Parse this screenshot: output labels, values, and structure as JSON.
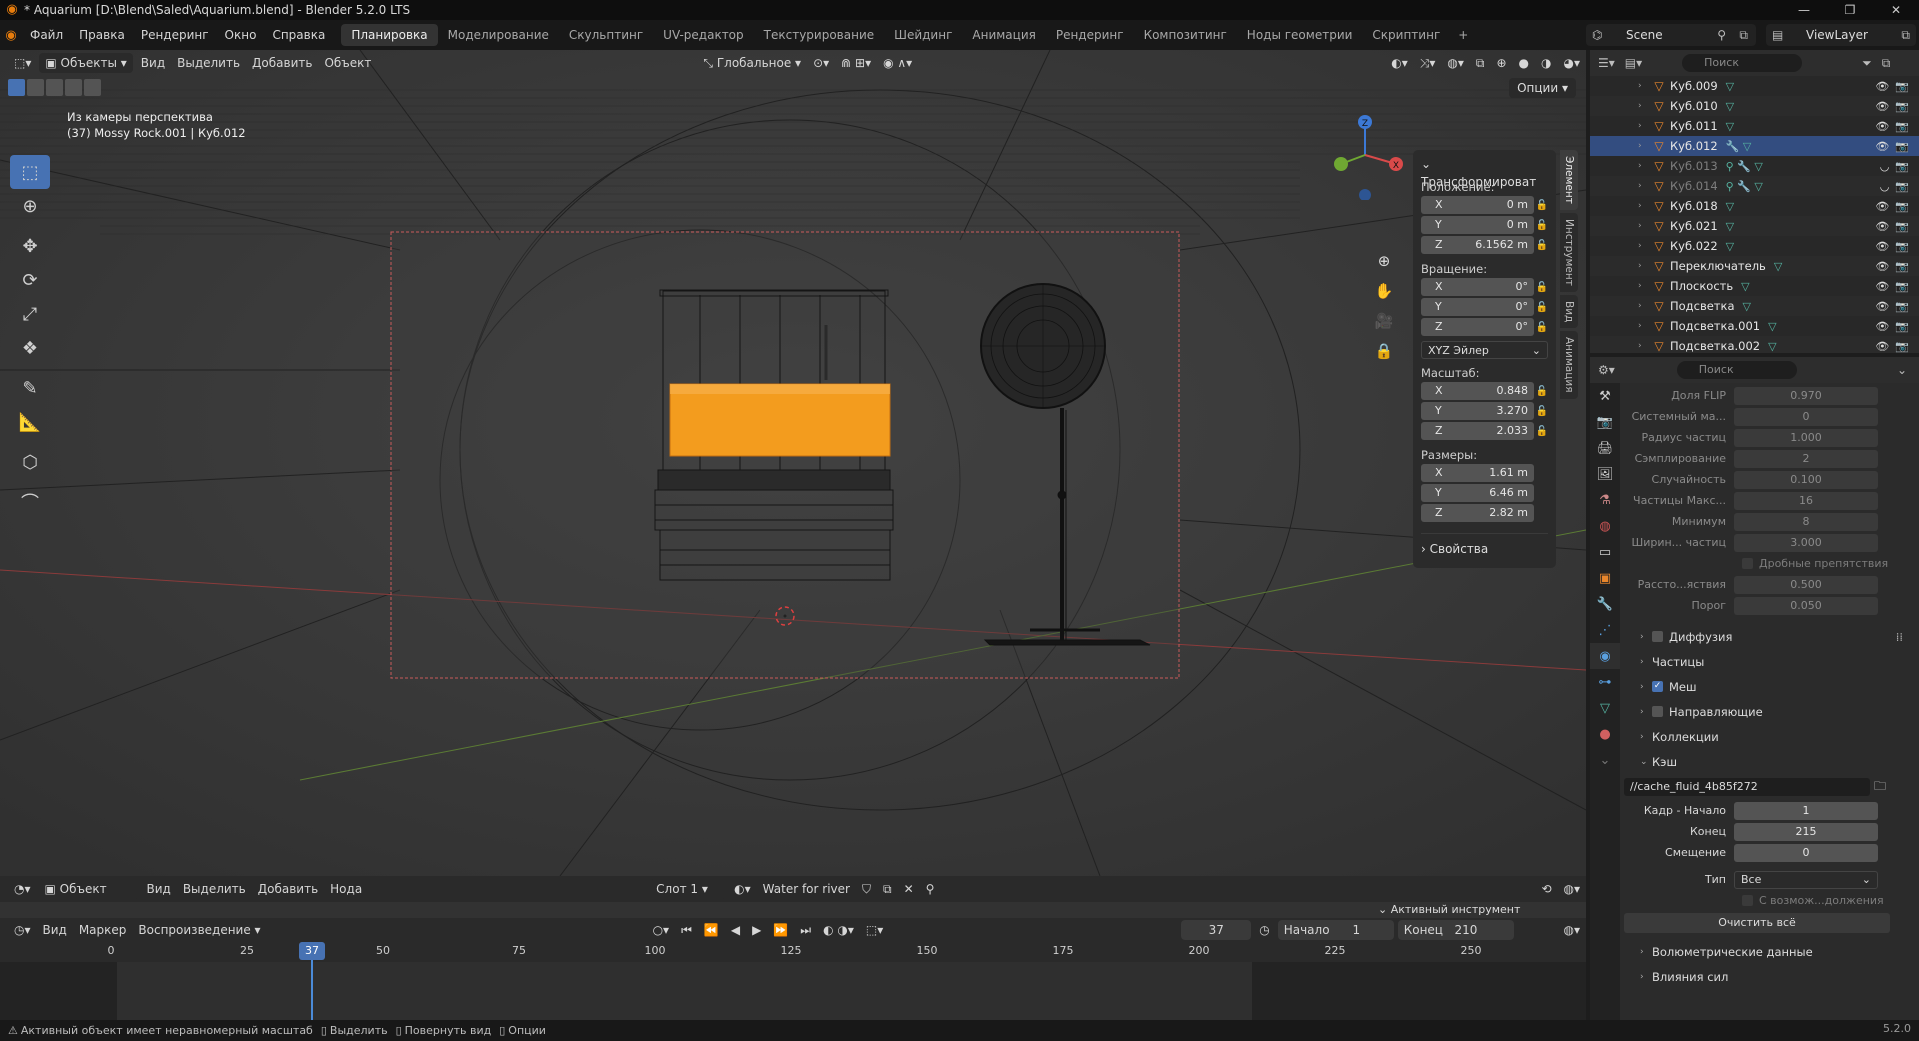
{
  "window": {
    "title": "* Aquarium [D:\\Blend\\Saled\\Aquarium.blend] - Blender 5.2.0 LTS",
    "controls": [
      "—",
      "❐",
      "✕"
    ]
  },
  "menu": [
    "Файл",
    "Правка",
    "Рендеринг",
    "Окно",
    "Справка"
  ],
  "workspaces": {
    "tabs": [
      "Планировка",
      "Моделирование",
      "Скульптинг",
      "UV-редактор",
      "Текстурирование",
      "Шейдинг",
      "Анимация",
      "Рендеринг",
      "Композитинг",
      "Ноды геометрии",
      "Скриптинг"
    ],
    "active": "Планировка"
  },
  "scene": {
    "name": "Scene",
    "view_layer": "ViewLayer"
  },
  "viewport": {
    "header": {
      "mode": "Объекты",
      "menus": [
        "Вид",
        "Выделить",
        "Добавить",
        "Объект"
      ],
      "orientation": "Глобальное"
    },
    "overlay_line1": "Из камеры перспектива",
    "overlay_line2": "(37) Mossy Rock.001 | Куб.012",
    "options": "Опции"
  },
  "npanel": {
    "section": "Трансформироват",
    "location_label": "Положение:",
    "location": {
      "x": "0 m",
      "y": "0 m",
      "z": "6.1562 m"
    },
    "rotation_label": "Вращение:",
    "rotation": {
      "x": "0°",
      "y": "0°",
      "z": "0°"
    },
    "rotation_mode": "XYZ Эйлер",
    "scale_label": "Масштаб:",
    "scale": {
      "x": "0.848",
      "y": "3.270",
      "z": "2.033"
    },
    "dims_label": "Размеры:",
    "dims": {
      "x": "1.61 m",
      "y": "6.46 m",
      "z": "2.82 m"
    },
    "props_section": "Свойства",
    "tabs": [
      "Элемент",
      "Инструмент",
      "Вид",
      "Анимация"
    ],
    "axis": {
      "x": "X",
      "y": "Y",
      "z": "Z"
    }
  },
  "shader_header": {
    "mode": "Объект",
    "menus": [
      "Вид",
      "Выделить",
      "Добавить",
      "Нода"
    ],
    "slot": "Слот 1",
    "material": "Water for river",
    "active_tool": "Активный инструмент"
  },
  "timeline": {
    "menus": [
      "Вид",
      "Маркер"
    ],
    "playback": "Воспроизведение",
    "current_frame": "37",
    "start_label": "Начало",
    "start": "1",
    "end_label": "Конец",
    "end": "210",
    "ticks": [
      "0",
      "25",
      "50",
      "75",
      "100",
      "125",
      "150",
      "175",
      "200",
      "225",
      "250"
    ],
    "cursor": "37"
  },
  "statusbar": {
    "warning": "Активный объект имеет неравномерный масштаб",
    "hints": [
      "Выделить",
      "Повернуть вид",
      "Опции"
    ],
    "version": "5.2.0"
  },
  "outliner": {
    "search_placeholder": "Поиск",
    "rows": [
      {
        "name": "Куб.009",
        "extra": "▽",
        "state": "normal"
      },
      {
        "name": "Куб.010",
        "extra": "▽",
        "state": "normal"
      },
      {
        "name": "Куб.011",
        "extra": "▽",
        "state": "normal"
      },
      {
        "name": "Куб.012",
        "extra": "🔧 ▽",
        "state": "selected"
      },
      {
        "name": "Куб.013",
        "extra": "⚲ 🔧 ▽",
        "state": "dim"
      },
      {
        "name": "Куб.014",
        "extra": "⚲ 🔧 ▽",
        "state": "dim"
      },
      {
        "name": "Куб.018",
        "extra": "▽",
        "state": "normal"
      },
      {
        "name": "Куб.021",
        "extra": "▽",
        "state": "normal"
      },
      {
        "name": "Куб.022",
        "extra": "▽",
        "state": "normal"
      },
      {
        "name": "Переключатель",
        "extra": "▽",
        "state": "normal"
      },
      {
        "name": "Плоскость",
        "extra": "▽",
        "state": "normal"
      },
      {
        "name": "Подсветка",
        "extra": "▽",
        "state": "normal"
      },
      {
        "name": "Подсветка.001",
        "extra": "▽",
        "state": "normal"
      },
      {
        "name": "Подсветка.002",
        "extra": "▽",
        "state": "normal"
      }
    ]
  },
  "properties": {
    "search_placeholder": "Поиск",
    "fields": [
      {
        "label": "Доля FLIP",
        "value": "0.970"
      },
      {
        "label": "Системный ма...",
        "value": "0"
      },
      {
        "label": "Радиус частиц",
        "value": "1.000"
      },
      {
        "label": "Сэмплирование",
        "value": "2"
      },
      {
        "label": "Случайность",
        "value": "0.100"
      },
      {
        "label": "Частицы Макс...",
        "value": "16"
      },
      {
        "label": "Минимум",
        "value": "8"
      },
      {
        "label": "Ширин... частиц",
        "value": "3.000"
      }
    ],
    "fractional_obstacles": "Дробные препятствия",
    "fields2": [
      {
        "label": "Рассто...яствия",
        "value": "0.500"
      },
      {
        "label": "Порог",
        "value": "0.050"
      }
    ],
    "subpanels": [
      {
        "label": "Диффузия",
        "checkbox": true,
        "checked": false
      },
      {
        "label": "Частицы",
        "checkbox": false,
        "checked": false
      },
      {
        "label": "Меш",
        "checkbox": true,
        "checked": true
      },
      {
        "label": "Направляющие",
        "checkbox": true,
        "checked": false
      },
      {
        "label": "Коллекции",
        "checkbox": false,
        "checked": false
      }
    ],
    "cache": {
      "label": "Кэш",
      "path": "//cache_fluid_4b85f272",
      "frame_start_label": "Кадр - Начало",
      "frame_start": "1",
      "end_label": "Конец",
      "end": "215",
      "offset_label": "Смещение",
      "offset": "0",
      "type_label": "Тип",
      "type": "Все",
      "resumable": "С возмож...должения",
      "free_all": "Очистить всё"
    },
    "subpanels2": [
      "Волюметрические данные",
      "Влияния сил"
    ]
  },
  "colors": {
    "accent": "#4772b3",
    "selected_object": "#f39c1e",
    "object_icon": "#e8862c",
    "viewport_bg": "#3b3b3b"
  }
}
